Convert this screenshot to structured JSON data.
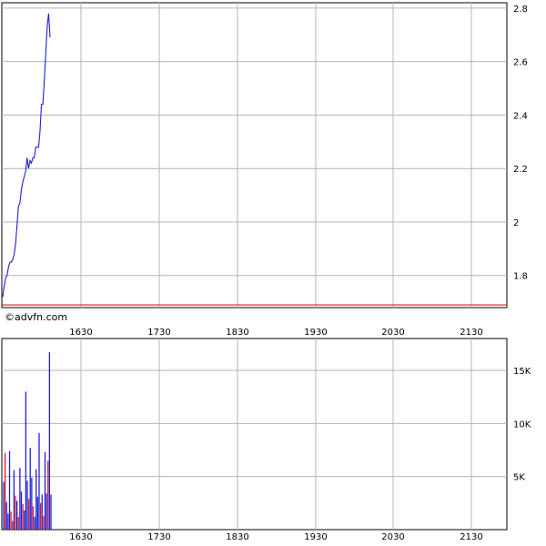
{
  "watermark": "©advfn.com",
  "colors": {
    "price_line": "#1f1fd6",
    "reference_line": "#e01b1b",
    "grid": "#b4b4b4",
    "frame": "#000000",
    "volume_up": "#1f1fd6",
    "volume_down": "#e01b1b"
  },
  "chart_data": [
    {
      "type": "line",
      "title": "",
      "xlabel": "",
      "ylabel": "",
      "x_tick_labels": [
        "1630",
        "1730",
        "1830",
        "1930",
        "2030",
        "2130"
      ],
      "y_tick_labels": [
        "1.8",
        "2",
        "2.2",
        "2.4",
        "2.6",
        "2.8"
      ],
      "ylim": [
        1.68,
        2.82
      ],
      "grid": true,
      "y_axis_side": "right",
      "reference_line": 1.69,
      "series": [
        {
          "values": [
            1.72,
            1.76,
            1.79,
            1.8,
            1.83,
            1.85,
            1.85,
            1.86,
            1.88,
            1.92,
            1.99,
            2.06,
            2.07,
            2.12,
            2.15,
            2.17,
            2.19,
            2.24,
            2.2,
            2.23,
            2.22,
            2.24,
            2.24,
            2.28,
            2.28,
            2.28,
            2.34,
            2.44,
            2.44,
            2.53,
            2.63,
            2.73,
            2.78,
            2.69
          ]
        }
      ]
    },
    {
      "type": "bar",
      "title": "",
      "xlabel": "",
      "ylabel": "",
      "x_tick_labels": [
        "1630",
        "1730",
        "1830",
        "1930",
        "2030",
        "2130"
      ],
      "y_tick_labels": [
        "5K",
        "10K",
        "15K"
      ],
      "ylim": [
        0,
        18000
      ],
      "grid": true,
      "y_axis_side": "right",
      "series": [
        {
          "values": [
            4500,
            7200,
            2600,
            1500,
            7400,
            1700,
            800,
            5600,
            3200,
            2700,
            1200,
            5800,
            3600,
            2400,
            1800,
            13000,
            4600,
            2900,
            7700,
            4900,
            2200,
            1200,
            5700,
            3100,
            9100,
            2500,
            3300,
            1300,
            7300,
            3400,
            6500,
            16700,
            3300
          ],
          "directions": [
            "u",
            "d",
            "u",
            "u",
            "u",
            "d",
            "d",
            "u",
            "d",
            "u",
            "d",
            "u",
            "u",
            "d",
            "u",
            "u",
            "u",
            "d",
            "u",
            "u",
            "d",
            "u",
            "u",
            "u",
            "u",
            "d",
            "u",
            "d",
            "u",
            "u",
            "d",
            "u",
            "u"
          ]
        }
      ]
    }
  ]
}
